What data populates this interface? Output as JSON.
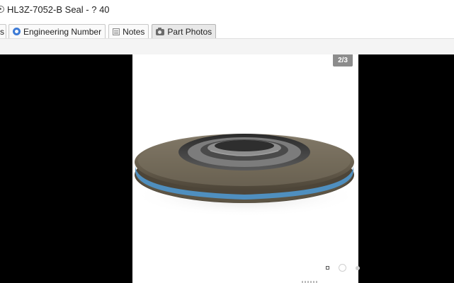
{
  "title": "HL3Z-7052-B Seal - ? 40",
  "tabs": [
    {
      "label": "s",
      "icon": "partial-tab",
      "active": false
    },
    {
      "label": "Engineering Number",
      "icon": "gear-icon",
      "active": false
    },
    {
      "label": "Notes",
      "icon": "notes-icon",
      "active": false
    },
    {
      "label": "Part Photos",
      "icon": "camera-icon",
      "active": true
    }
  ],
  "viewer": {
    "counter": "2/3",
    "image_subject": "seal",
    "dots_total": 3,
    "current_index": 2
  },
  "colors": {
    "viewer_bg": "#000000",
    "seal_body": "#6b6251",
    "seal_stripe": "#4f8fbf",
    "counter_bg": "#8c8c8c"
  }
}
